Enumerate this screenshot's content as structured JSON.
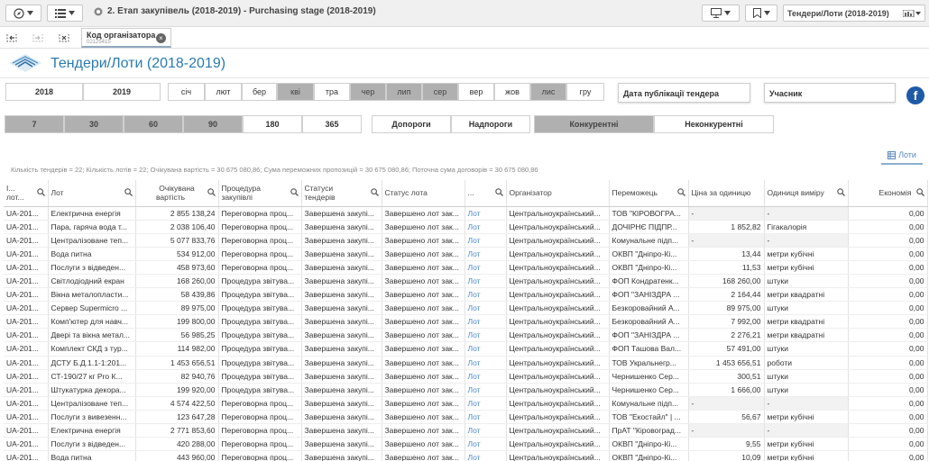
{
  "app": {
    "sheet_title": "2. Етап закупівель (2018-2019) - Purchasing stage (2018-2019)",
    "bookmark_title": "Тендери/Лоти (2018-2019)"
  },
  "selection": {
    "field": "Код організатора",
    "value": "02125415"
  },
  "page": {
    "title": "Тендери/Лоти (2018-2019)"
  },
  "years": [
    "2018",
    "2019"
  ],
  "months": [
    {
      "l": "січ",
      "s": "white"
    },
    {
      "l": "лют",
      "s": "white"
    },
    {
      "l": "бер",
      "s": "white"
    },
    {
      "l": "кві",
      "s": "gray"
    },
    {
      "l": "тра",
      "s": "white"
    },
    {
      "l": "чер",
      "s": "gray"
    },
    {
      "l": "лип",
      "s": "gray"
    },
    {
      "l": "сер",
      "s": "gray"
    },
    {
      "l": "вер",
      "s": "white"
    },
    {
      "l": "жов",
      "s": "white"
    },
    {
      "l": "лис",
      "s": "gray"
    },
    {
      "l": "гру",
      "s": "white"
    }
  ],
  "dropdowns": {
    "date": "Дата публікації тендера",
    "participant": "Учасник"
  },
  "days": [
    {
      "l": "7",
      "s": "gray"
    },
    {
      "l": "30",
      "s": "gray"
    },
    {
      "l": "60",
      "s": "gray"
    },
    {
      "l": "90",
      "s": "gray"
    },
    {
      "l": "180",
      "s": "white"
    },
    {
      "l": "365",
      "s": "white"
    }
  ],
  "thresholds": [
    "Допороги",
    "Надпороги"
  ],
  "competition": [
    {
      "l": "Конкурентні",
      "s": "gray"
    },
    {
      "l": "Неконкурентні",
      "s": "white"
    }
  ],
  "summary": "Кількість тендерів = 22; Кількість лотів = 22; Очікувана вартість = 30 675 080,86; Сума переможних пропозицій = 30 675 080,86; Поточна сума договорів = 30 675 080,86",
  "lots_tab": "Лоти",
  "columns": [
    "І... лот...",
    "Лот",
    "Очікувана вартість",
    "Процедура закупівлі",
    "Статуси тендерів",
    "Статус лота",
    "...",
    "Організатор",
    "Переможець",
    "Ціна за одиницю",
    "Одиниця виміру",
    "Економія"
  ],
  "colors": {
    "accent": "#2a7ab0",
    "gray_button": "#b0b0b0",
    "link": "#4a8ad0"
  },
  "rows": [
    [
      "UA-201...",
      "Електрична енергія",
      "2 855 138,24",
      "Переговорна проц...",
      "Завершена закупі...",
      "Завершено лот зак...",
      "Лот",
      "Центральноукраїнський...",
      "ТОВ \"КІРОВОГРА...",
      "-",
      "-",
      "0,00"
    ],
    [
      "UA-201...",
      "Пара, гаряча вода т...",
      "2 038 106,40",
      "Переговорна проц...",
      "Завершена закупі...",
      "Завершено лот зак...",
      "Лот",
      "Центральноукраїнський...",
      "ДОЧІРНЄ ПІДПР...",
      "1 852,82",
      "Гігакалорія",
      "0,00"
    ],
    [
      "UA-201...",
      "Централізоване теп...",
      "5 077 833,76",
      "Переговорна проц...",
      "Завершена закупі...",
      "Завершено лот зак...",
      "Лот",
      "Центральноукраїнський...",
      "Комунальне підп...",
      "-",
      "-",
      "0,00"
    ],
    [
      "UA-201...",
      "Вода питна",
      "534 912,00",
      "Переговорна проц...",
      "Завершена закупі...",
      "Завершено лот зак...",
      "Лот",
      "Центральноукраїнський...",
      "ОКВП \"Дніпро-Кі...",
      "13,44",
      "метри кубічні",
      "0,00"
    ],
    [
      "UA-201...",
      "Послуги з відведен...",
      "458 973,60",
      "Переговорна проц...",
      "Завершена закупі...",
      "Завершено лот зак...",
      "Лот",
      "Центральноукраїнський...",
      "ОКВП \"Дніпро-Кі...",
      "11,53",
      "метри кубічні",
      "0,00"
    ],
    [
      "UA-201...",
      "Світлодіодний екран",
      "168 260,00",
      "Процедура звітува...",
      "Завершена закупі...",
      "Завершено лот зак...",
      "Лот",
      "Центральноукраїнський...",
      "ФОП Кондратенк...",
      "168 260,00",
      "штуки",
      "0,00"
    ],
    [
      "UA-201...",
      "Вікна металопласти...",
      "58 439,86",
      "Процедура звітува...",
      "Завершена закупі...",
      "Завершено лот зак...",
      "Лот",
      "Центральноукраїнський...",
      "ФОП \"ЗАНІЗДРА ...",
      "2 164,44",
      "метри квадратні",
      "0,00"
    ],
    [
      "UA-201...",
      "Сервер Supermicro ...",
      "89 975,00",
      "Процедура звітува...",
      "Завершена закупі...",
      "Завершено лот зак...",
      "Лот",
      "Центральноукраїнський...",
      "Безкоровайний А...",
      "89 975,00",
      "штуки",
      "0,00"
    ],
    [
      "UA-201...",
      "Комп'ютер для навч...",
      "199 800,00",
      "Процедура звітува...",
      "Завершена закупі...",
      "Завершено лот зак...",
      "Лот",
      "Центральноукраїнський...",
      "Безкоровайний А...",
      "7 992,00",
      "метри квадратні",
      "0,00"
    ],
    [
      "UA-201...",
      "Двері та вікна метал...",
      "56 985,25",
      "Процедура звітува...",
      "Завершена закупі...",
      "Завершено лот зак...",
      "Лот",
      "Центральноукраїнський...",
      "ФОП \"ЗАНІЗДРА ...",
      "2 276,21",
      "метри квадратні",
      "0,00"
    ],
    [
      "UA-201...",
      "Комплект СКД з тур...",
      "114 982,00",
      "Процедура звітува...",
      "Завершена закупі...",
      "Завершено лот зак...",
      "Лот",
      "Центральноукраїнський...",
      "ФОП Ташова Вал...",
      "57 491,00",
      "штуки",
      "0,00"
    ],
    [
      "UA-201...",
      "ДСТУ Б.Д.1.1-1:201...",
      "1 453 656,51",
      "Процедура звітува...",
      "Завершена закупі...",
      "Завершено лот зак...",
      "Лот",
      "Центральноукраїнський...",
      "ТОВ Укральнегр...",
      "1 453 656,51",
      "роботи",
      "0,00"
    ],
    [
      "UA-201...",
      "СТ-190/27 кг Pro К...",
      "82 940,76",
      "Процедура звітува...",
      "Завершена закупі...",
      "Завершено лот зак...",
      "Лот",
      "Центральноукраїнський...",
      "Чернишенко Сер...",
      "300,51",
      "штуки",
      "0,00"
    ],
    [
      "UA-201...",
      "Штукатурка декора...",
      "199 920,00",
      "Процедура звітува...",
      "Завершена закупі...",
      "Завершено лот зак...",
      "Лот",
      "Центральноукраїнський...",
      "Чернишенко Сер...",
      "1 666,00",
      "штуки",
      "0,00"
    ],
    [
      "UA-201...",
      "Централізоване теп...",
      "4 574 422,50",
      "Переговорна проц...",
      "Завершена закупі...",
      "Завершено лот зак...",
      "Лот",
      "Центральноукраїнський...",
      "Комунальне підп...",
      "-",
      "-",
      "0,00"
    ],
    [
      "UA-201...",
      "Послуги з вивезенн...",
      "123 647,28",
      "Переговорна проц...",
      "Завершена закупі...",
      "Завершено лот зак...",
      "Лот",
      "Центральноукраїнський...",
      "ТОВ \"Екостайл\" | ...",
      "56,67",
      "метри кубічні",
      "0,00"
    ],
    [
      "UA-201...",
      "Електрична енергія",
      "2 771 853,60",
      "Переговорна проц...",
      "Завершена закупі...",
      "Завершено лот зак...",
      "Лот",
      "Центральноукраїнський...",
      "ПрАТ \"Кіровоград...",
      "-",
      "-",
      "0,00"
    ],
    [
      "UA-201...",
      "Послуги з відведен...",
      "420 288,00",
      "Переговорна проц...",
      "Завершена закупі...",
      "Завершено лот зак...",
      "Лот",
      "Центральноукраїнський...",
      "ОКВП \"Дніпро-Кі...",
      "9,55",
      "метри кубічні",
      "0,00"
    ],
    [
      "UA-201...",
      "Вода питна",
      "443 960,00",
      "Переговорна проц...",
      "Завершена закупі...",
      "Завершено лот зак...",
      "Лот",
      "Центральноукраїнський...",
      "ОКВП \"Дніпро-Кі...",
      "10,09",
      "метри кубічні",
      "0,00"
    ]
  ]
}
